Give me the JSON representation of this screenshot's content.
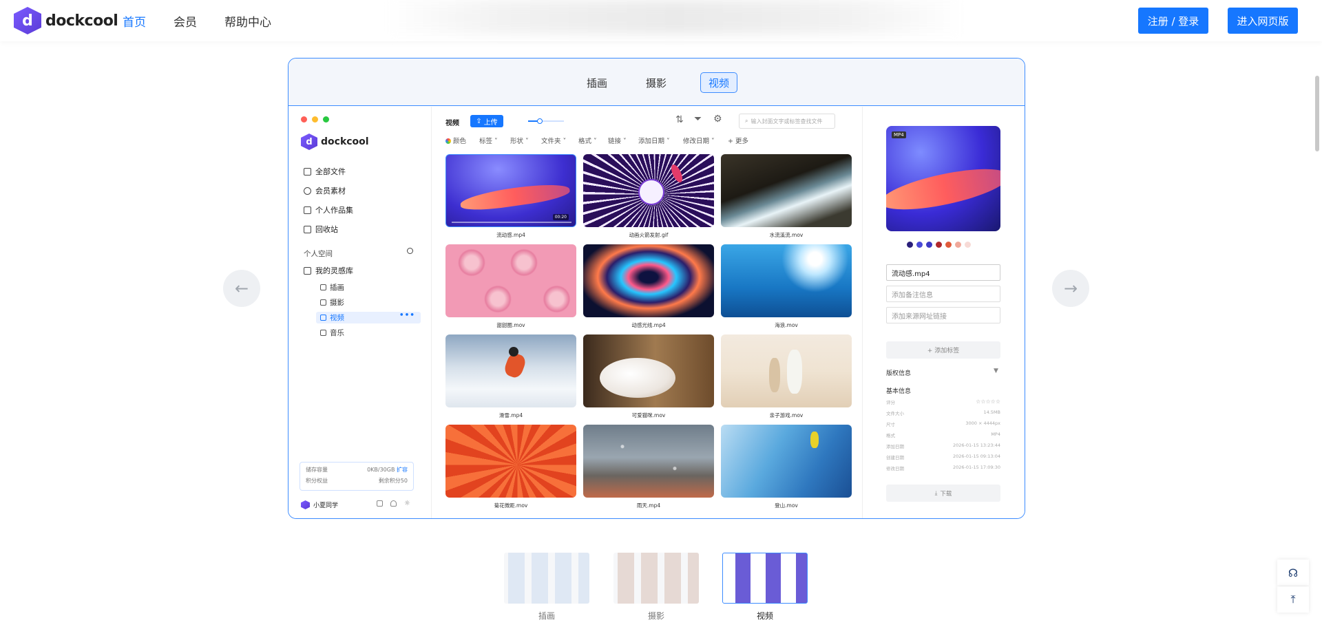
{
  "header": {
    "logo_text": "dockcool",
    "logo_letter": "d",
    "nav": [
      {
        "label": "首页",
        "active": true
      },
      {
        "label": "会员",
        "active": false
      },
      {
        "label": "帮助中心",
        "active": false
      }
    ],
    "login_button": "注册 / 登录",
    "web_button": "进入网页版"
  },
  "frame_tabs": [
    {
      "label": "插画",
      "active": false
    },
    {
      "label": "摄影",
      "active": false
    },
    {
      "label": "视频",
      "active": true
    }
  ],
  "carousel": {
    "prev_icon": "arrow-left-icon",
    "next_icon": "arrow-right-icon"
  },
  "app": {
    "sidebar": {
      "logo_text": "dockcool",
      "logo_letter": "d",
      "items": [
        {
          "label": "全部文件",
          "icon": "layers-icon"
        },
        {
          "label": "会员素材",
          "icon": "lightbulb-icon"
        },
        {
          "label": "个人作品集",
          "icon": "portfolio-icon"
        },
        {
          "label": "回收站",
          "icon": "trash-icon"
        }
      ],
      "space_title": "个人空间",
      "library": "我的灵感库",
      "folders": [
        {
          "label": "插画",
          "active": false
        },
        {
          "label": "摄影",
          "active": false
        },
        {
          "label": "视频",
          "active": true
        },
        {
          "label": "音乐",
          "active": false
        }
      ],
      "storage": {
        "label": "储存容量",
        "value": "0KB/30GB",
        "action": "扩容",
        "points_label": "积分权益",
        "points_value": "剩余积分50"
      },
      "user": "小夏同学"
    },
    "toolbar": {
      "title": "视频",
      "upload": "上传",
      "search_placeholder": "输入封面文字或标签查找文件",
      "filters": [
        "颜色",
        "标签",
        "形状",
        "文件夹",
        "格式",
        "链接",
        "添加日期",
        "修改日期",
        "+ 更多"
      ]
    },
    "tiles": [
      {
        "name": "流动感.mp4",
        "duration": "00:20"
      },
      {
        "name": "动画火箭发射.gif"
      },
      {
        "name": "水流溪流.mov"
      },
      {
        "name": "甜甜圈.mov"
      },
      {
        "name": "动感光线.mp4"
      },
      {
        "name": "海浪.mov"
      },
      {
        "name": "滑雪.mp4"
      },
      {
        "name": "可爱猫咪.mov"
      },
      {
        "name": "亲子游戏.mov"
      },
      {
        "name": "菊花微距.mov"
      },
      {
        "name": "雨天.mp4"
      },
      {
        "name": "登山.mov"
      }
    ],
    "detail": {
      "badge": "MP4",
      "swatches": [
        "#2a1f7a",
        "#4a4ad8",
        "#3d3ac4",
        "#b0282c",
        "#e05a3a",
        "#f0a89a",
        "#f7dad6"
      ],
      "filename": "流动感.mp4",
      "note_placeholder": "添加备注信息",
      "link_placeholder": "添加来源网址链接",
      "add_tag": "+ 添加标签",
      "copyright": "版权信息",
      "basic": "基本信息",
      "rows": [
        {
          "k": "评分",
          "v": "☆☆☆☆☆"
        },
        {
          "k": "文件大小",
          "v": "14.5MB"
        },
        {
          "k": "尺寸",
          "v": "3000 × 4444px"
        },
        {
          "k": "格式",
          "v": "MP4"
        },
        {
          "k": "添加日期",
          "v": "2026-01-15 13:23:44"
        },
        {
          "k": "创建日期",
          "v": "2026-01-15 09:13:04"
        },
        {
          "k": "修改日期",
          "v": "2026-01-15 17:09:30"
        }
      ],
      "download": "下载"
    }
  },
  "thumbnails": [
    {
      "label": "插画",
      "active": false
    },
    {
      "label": "摄影",
      "active": false
    },
    {
      "label": "视频",
      "active": true
    }
  ],
  "floating": {
    "support_icon": "headset-icon",
    "top_icon": "back-to-top-icon"
  }
}
